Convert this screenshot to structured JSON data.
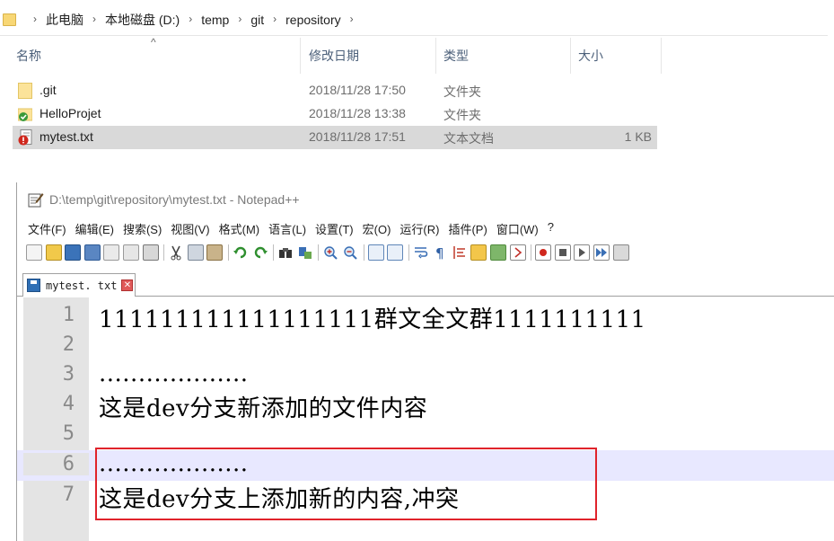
{
  "explorer": {
    "breadcrumb": [
      "此电脑",
      "本地磁盘 (D:)",
      "temp",
      "git",
      "repository"
    ],
    "columns": {
      "name": "名称",
      "date": "修改日期",
      "type": "类型",
      "size": "大小"
    },
    "files": [
      {
        "name": ".git",
        "date": "2018/11/28 17:50",
        "type": "文件夹",
        "size": "",
        "icon": "folder-icon"
      },
      {
        "name": "HelloProjet",
        "date": "2018/11/28 13:38",
        "type": "文件夹",
        "size": "",
        "icon": "git-folder-icon"
      },
      {
        "name": "mytest.txt",
        "date": "2018/11/28 17:51",
        "type": "文本文档",
        "size": "1 KB",
        "icon": "conflict-text-file-icon"
      }
    ]
  },
  "notepad": {
    "title": "D:\\temp\\git\\repository\\mytest.txt - Notepad++",
    "menu": [
      "文件(F)",
      "编辑(E)",
      "搜索(S)",
      "视图(V)",
      "格式(M)",
      "语言(L)",
      "设置(T)",
      "宏(O)",
      "运行(R)",
      "插件(P)",
      "窗口(W)",
      "?"
    ],
    "tab_label": "mytest. txt",
    "lines": [
      {
        "num": "1",
        "text": "111111111111111111群文全文群1111111111"
      },
      {
        "num": "2",
        "text": ""
      },
      {
        "num": "3",
        "text": "..................."
      },
      {
        "num": "4",
        "text": "这是dev分支新添加的文件内容"
      },
      {
        "num": "5",
        "text": ""
      },
      {
        "num": "6",
        "text": "..................."
      },
      {
        "num": "7",
        "text": "这是dev分支上添加新的内容,冲突"
      }
    ],
    "current_line": 6
  },
  "colors": {
    "highlight_box": "#e0232b",
    "current_line_bg": "#e8e8ff",
    "selected_row_bg": "#d9d9d9"
  }
}
